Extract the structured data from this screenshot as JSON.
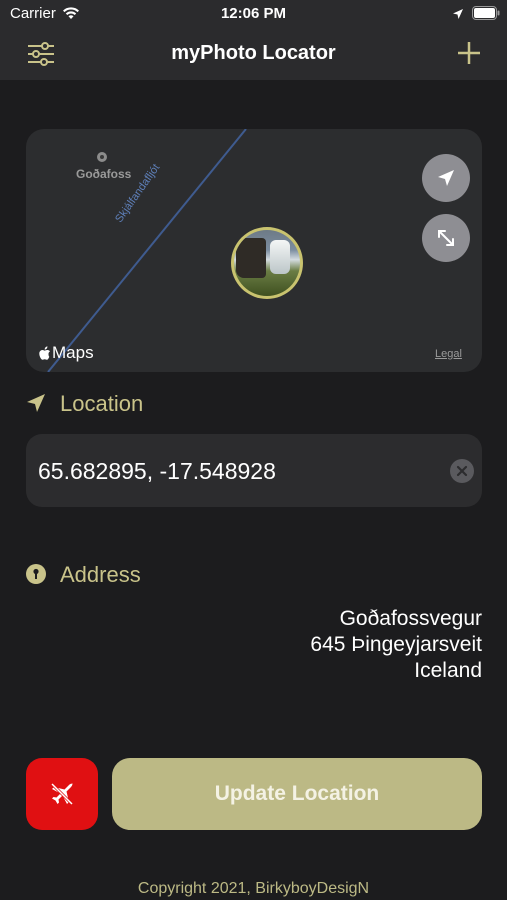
{
  "status_bar": {
    "carrier": "Carrier",
    "time": "12:06 PM"
  },
  "nav": {
    "title": "myPhoto Locator",
    "left_icon": "sliders-icon",
    "right_icon": "plus-icon"
  },
  "map": {
    "poi_label": "Goðafoss",
    "river_label": "Skjálfandafljót",
    "attribution": "Maps",
    "legal": "Legal"
  },
  "location": {
    "label": "Location",
    "coordinates": "65.682895, -17.548928"
  },
  "address": {
    "label": "Address",
    "lines": [
      "Goðafossvegur",
      "645 Þingeyjarsveit",
      "Iceland"
    ]
  },
  "actions": {
    "update_label": "Update Location"
  },
  "footer": {
    "copyright": "Copyright 2021, BirkyboyDesigN"
  },
  "colors": {
    "accent": "#c9c38a",
    "button": "#bcb985",
    "danger": "#e01012",
    "background": "#1c1c1e"
  }
}
